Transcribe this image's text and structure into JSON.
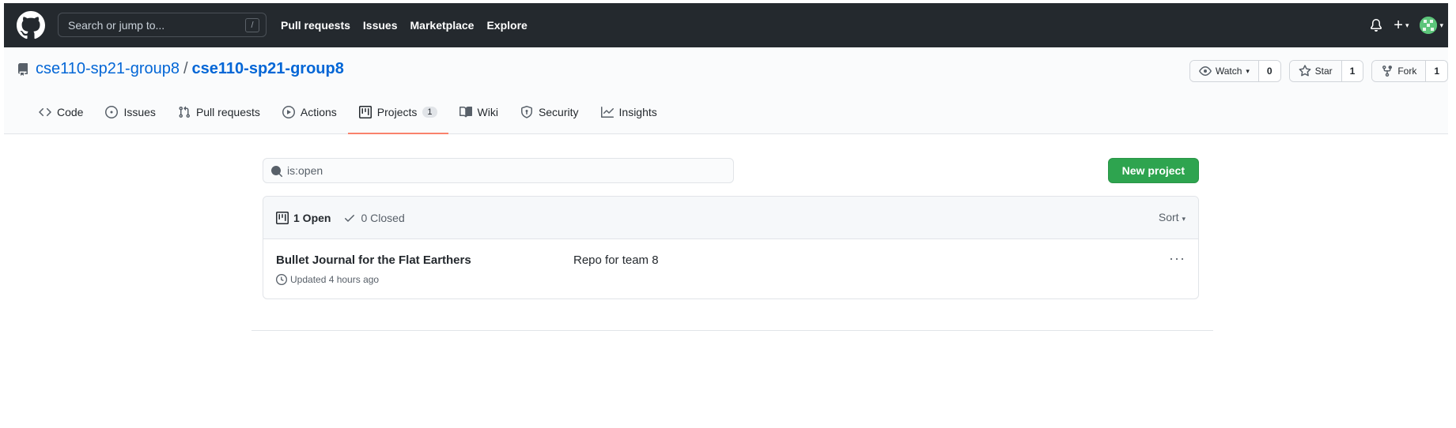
{
  "header": {
    "search_placeholder": "Search or jump to...",
    "search_key": "/",
    "nav": [
      "Pull requests",
      "Issues",
      "Marketplace",
      "Explore"
    ],
    "plus_label": "+"
  },
  "repo": {
    "owner": "cse110-sp21-group8",
    "separator": "/",
    "name": "cse110-sp21-group8",
    "watch_label": "Watch",
    "watch_count": "0",
    "star_label": "Star",
    "star_count": "1",
    "fork_label": "Fork",
    "fork_count": "1"
  },
  "tabs": [
    {
      "label": "Code",
      "icon": "code-icon"
    },
    {
      "label": "Issues",
      "icon": "issue-icon"
    },
    {
      "label": "Pull requests",
      "icon": "pull-request-icon"
    },
    {
      "label": "Actions",
      "icon": "play-icon"
    },
    {
      "label": "Projects",
      "icon": "project-icon",
      "counter": "1",
      "selected": true
    },
    {
      "label": "Wiki",
      "icon": "book-icon"
    },
    {
      "label": "Security",
      "icon": "shield-icon"
    },
    {
      "label": "Insights",
      "icon": "graph-icon"
    }
  ],
  "projects": {
    "filter_value": "is:open",
    "new_button": "New project",
    "open_label": "1 Open",
    "closed_label": "0 Closed",
    "sort_label": "Sort",
    "items": [
      {
        "title": "Bullet Journal for the Flat Earthers",
        "updated": "Updated 4 hours ago",
        "description": "Repo for team 8"
      }
    ]
  },
  "colors": {
    "header_bg": "#24292e",
    "link": "#0366d6",
    "primary_button": "#2ea44f",
    "selected_tab_underline": "#f9826c"
  }
}
